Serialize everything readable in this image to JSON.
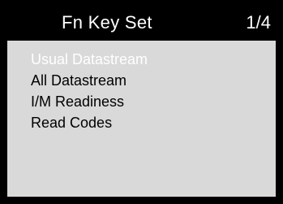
{
  "header": {
    "title": "Fn Key Set",
    "page_indicator": "1/4"
  },
  "menu": {
    "selected_index": 0,
    "items": [
      {
        "label": "Usual Datastream"
      },
      {
        "label": "All Datastream"
      },
      {
        "label": "I/M Readiness"
      },
      {
        "label": "Read Codes"
      }
    ]
  },
  "colors": {
    "background": "#d9d9d9",
    "title_bar": "#000000",
    "title_text": "#ffffff",
    "selected_text": "#ffffff",
    "item_text": "#000000",
    "frame": "#000000"
  }
}
